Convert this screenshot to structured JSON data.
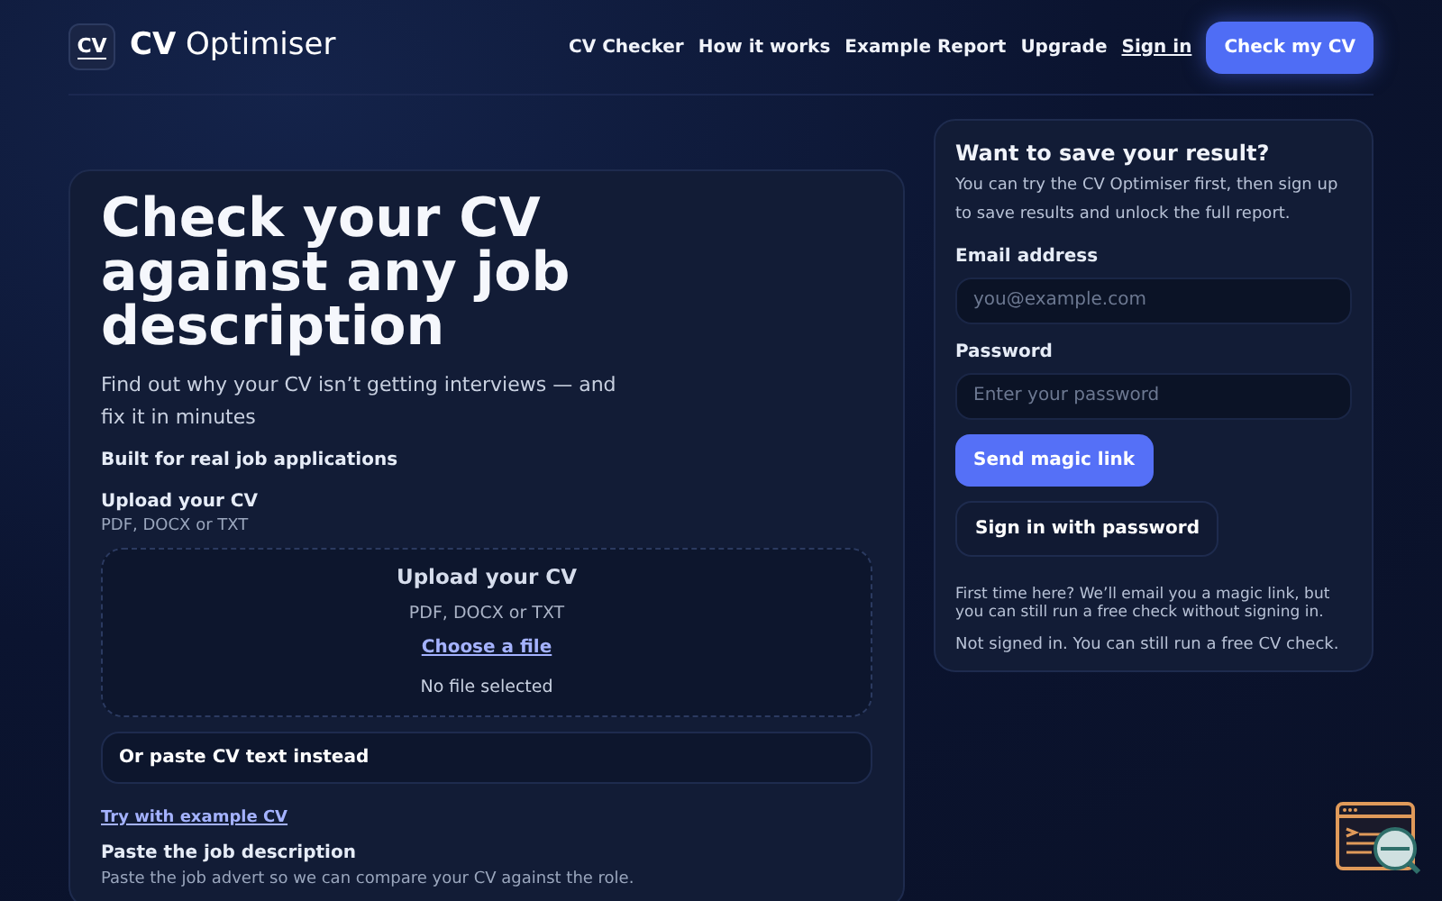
{
  "brand": {
    "logo_text": "CV",
    "name_bold": "CV",
    "name_rest": "Optimiser"
  },
  "nav": {
    "links": [
      {
        "label": "CV Checker",
        "kind": "plain"
      },
      {
        "label": "How it works",
        "kind": "plain"
      },
      {
        "label": "Example Report",
        "kind": "plain"
      },
      {
        "label": "Upgrade",
        "kind": "plain"
      },
      {
        "label": "Sign in",
        "kind": "underlined"
      }
    ],
    "cta": "Check my CV"
  },
  "hero": {
    "title": "Check your CV against any job description",
    "subtitle": "Find out why your CV isn’t getting interviews — and fix it in minutes",
    "tagline": "Built for real job applications"
  },
  "upload": {
    "label": "Upload your CV",
    "hint": "PDF, DOCX or TXT",
    "drop_title": "Upload your CV",
    "drop_hint": "PDF, DOCX or TXT",
    "choose": "Choose a file",
    "status": "No file selected"
  },
  "paste_toggle": "Or paste CV text instead",
  "example_link": "Try with example CV",
  "job": {
    "label": "Paste the job description",
    "hint": "Paste the job advert so we can compare your CV against the role."
  },
  "signup": {
    "title": "Want to save your result?",
    "intro": "You can try the CV Optimiser first, then sign up to save results and unlock the full report.",
    "fields": [
      {
        "label": "Email address",
        "placeholder": "you@example.com"
      },
      {
        "label": "Password",
        "placeholder": "Enter your password"
      }
    ],
    "primary_button": "Send magic link",
    "secondary_button": "Sign in with password",
    "note": "First time here? We’ll email you a magic link, but you can still run a free check without signing in.",
    "status": "Not signed in. You can still run a free CV check."
  }
}
